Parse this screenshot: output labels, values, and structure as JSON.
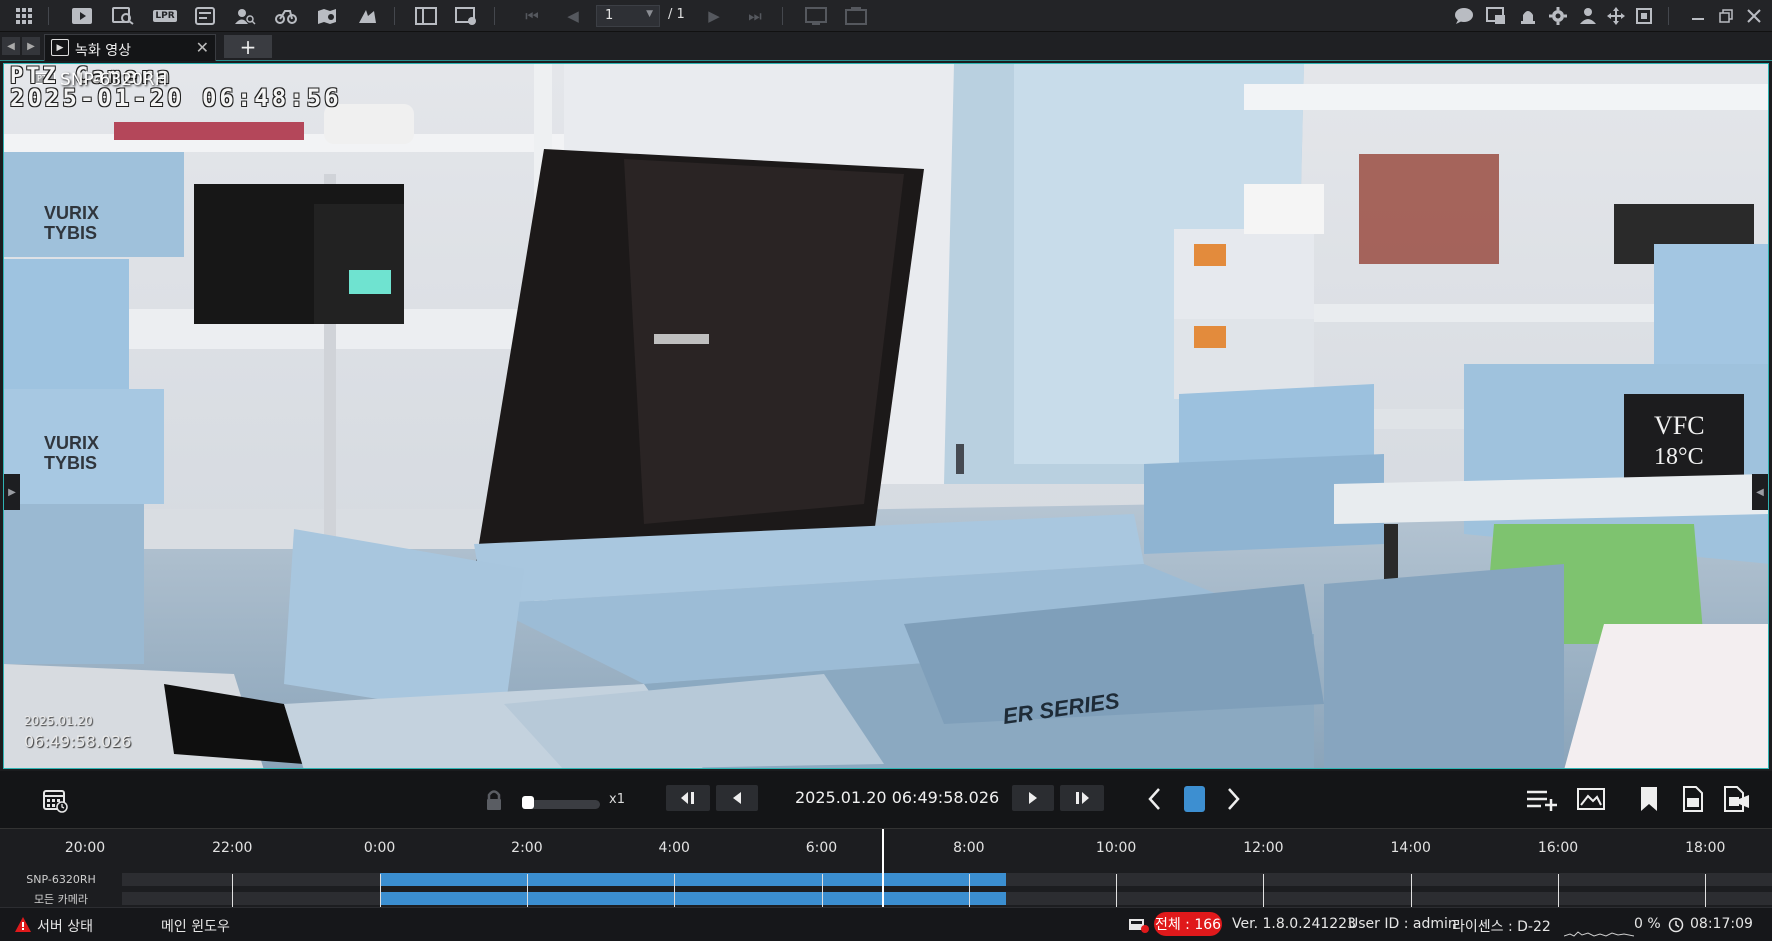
{
  "toolbar": {
    "page_current": "1",
    "page_total": "/ 1",
    "icons": [
      "grid-menu-icon",
      "live-view-icon",
      "playback-search-icon",
      "lpr-icon",
      "event-search-icon",
      "face-search-icon",
      "vehicle-search-icon",
      "map-search-icon",
      "thermal-icon",
      "layout-icon",
      "layout-add-icon",
      "first-page-icon",
      "prev-page-icon",
      "next-page-icon",
      "last-page-icon",
      "fit-icon",
      "capture-icon",
      "chat-icon",
      "message-icon",
      "alarm-icon",
      "settings-icon",
      "user-icon",
      "fullscreen-move-icon",
      "fit-screen-icon",
      "minimize-icon",
      "restore-icon",
      "close-icon"
    ],
    "lpr_text": "LPR"
  },
  "tabs": [
    {
      "label": "녹화 영상",
      "close": "✕"
    }
  ],
  "tab_add": "+",
  "video": {
    "osd_camera_name": "PTZ Camera",
    "osd_datetime": "2025-01-20  06:48:56",
    "ptz_badge": "PTZ",
    "camera_label": "SNP-6320RH",
    "overlay_date": "2025.01.20",
    "overlay_time": "06:49:58.026"
  },
  "controls": {
    "speed_label": "x1",
    "current_datetime": "2025.01.20 06:49:58.026"
  },
  "timeline": {
    "ticks": [
      "20:00",
      "22:00",
      "0:00",
      "2:00",
      "4:00",
      "6:00",
      "8:00",
      "10:00",
      "12:00",
      "14:00",
      "16:00",
      "18:00"
    ],
    "tracks": [
      {
        "label": "SNP-6320RH"
      },
      {
        "label": "모든 카메라"
      }
    ],
    "recording_range": [
      "0:00",
      "8:30"
    ],
    "cursor_time": "6:49"
  },
  "status": {
    "server_status": "서버 상태",
    "main_window": "메인 윈도우",
    "total_label": "전체 : 166",
    "version": "Ver. 1.8.0.241223",
    "user_id": "User ID : admin",
    "license": "라이센스 : D-22",
    "cpu": "0 %",
    "clock": "08:17:09"
  },
  "colors": {
    "accent": "#3b8ed0",
    "alert": "#e0191b",
    "frame_border": "#2fb3b3"
  }
}
